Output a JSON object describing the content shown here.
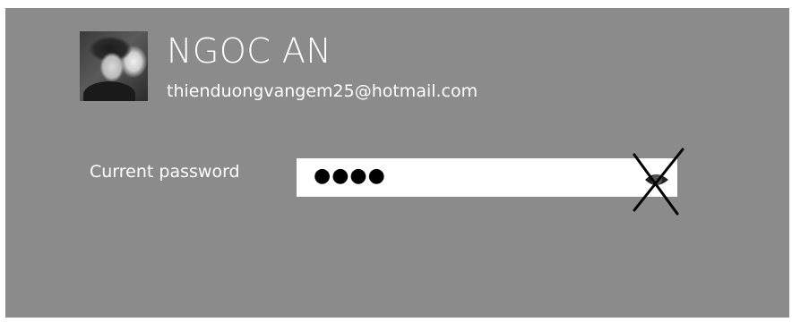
{
  "account": {
    "name": "NGOC AN",
    "email": "thienduongvangem25@hotmail.com",
    "avatar_icon": "user-photo"
  },
  "password_form": {
    "label": "Current password",
    "masked_value": "●●●●",
    "reveal_icon": "eye-icon-crossed-out"
  },
  "colors": {
    "background": "#8b8b8b",
    "text": "#ffffff",
    "field_bg": "#ffffff"
  }
}
